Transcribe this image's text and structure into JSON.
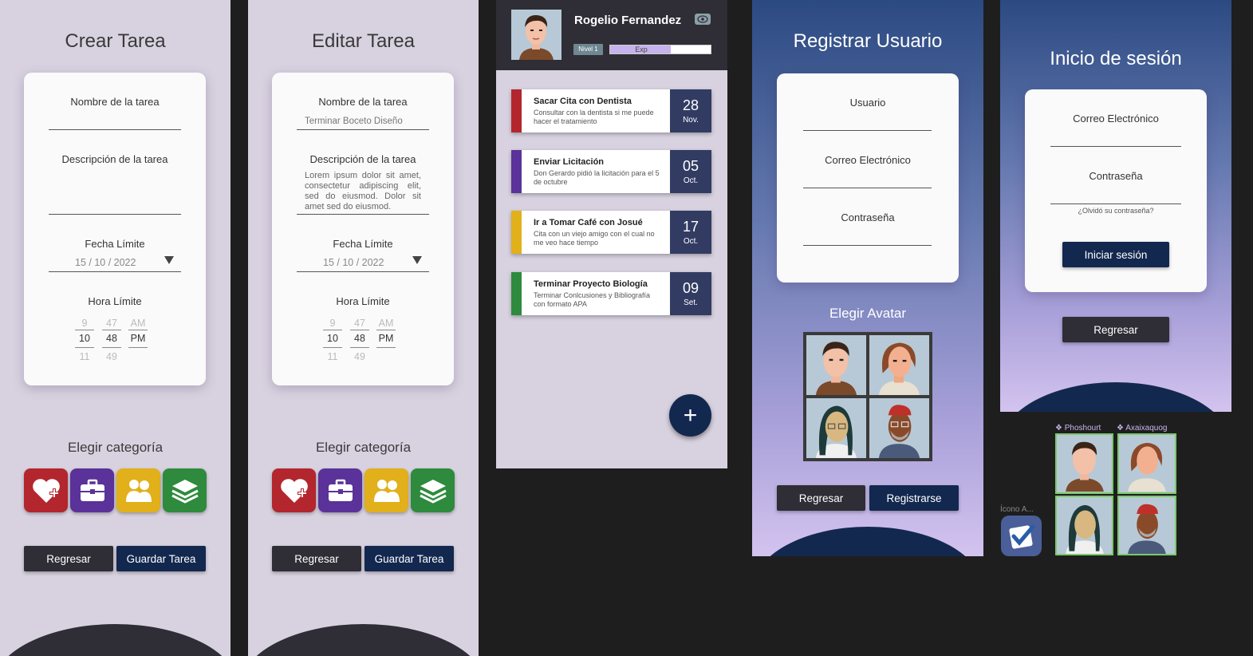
{
  "crear": {
    "title": "Crear Tarea",
    "name_label": "Nombre de la tarea",
    "desc_label": "Descripción de la tarea",
    "date_label": "Fecha Límite",
    "date_value": "15 / 10 / 2022",
    "time_label": "Hora Límite",
    "time": {
      "h_prev": "9",
      "m_prev": "47",
      "ap_prev": "AM",
      "h": "10",
      "m": "48",
      "ap": "PM",
      "h_next": "11",
      "m_next": "49"
    },
    "category_title": "Elegir categoría",
    "back_label": "Regresar",
    "save_label": "Guardar Tarea"
  },
  "editar": {
    "title": "Editar Tarea",
    "name_label": "Nombre de la tarea",
    "name_value": "Terminar Boceto Diseño",
    "desc_label": "Descripción de la tarea",
    "desc_value": "Lorem ipsum dolor sit amet, consectetur adipiscing elit, sed do eiusmod. Dolor sit amet sed do eiusmod.",
    "date_label": "Fecha Límite",
    "date_value": "15 / 10 / 2022",
    "time_label": "Hora Límite",
    "time": {
      "h_prev": "9",
      "m_prev": "47",
      "ap_prev": "AM",
      "h": "10",
      "m": "48",
      "ap": "PM",
      "h_next": "11",
      "m_next": "49"
    },
    "category_title": "Elegir categoría",
    "back_label": "Regresar",
    "save_label": "Guardar Tarea"
  },
  "categories": [
    {
      "icon": "heart-plus-icon",
      "color": "#b3262e"
    },
    {
      "icon": "briefcase-icon",
      "color": "#5a3299"
    },
    {
      "icon": "people-icon",
      "color": "#e1b01a"
    },
    {
      "icon": "books-icon",
      "color": "#2e8a3d"
    }
  ],
  "tasks_screen": {
    "user_name": "Rogelio Fernandez",
    "level": "Nivel 1",
    "exp_label": "Exp",
    "exp_progress": 0.6,
    "tasks": [
      {
        "title": "Sacar Cita con Dentista",
        "desc": "Consultar con la dentista si me puede hacer el tratamiento",
        "day": "28",
        "month": "Nov.",
        "color": "#b3262e"
      },
      {
        "title": "Enviar Licitación",
        "desc": "Don Gerardo pidió la licitación para el 5 de octubre",
        "day": "05",
        "month": "Oct.",
        "color": "#5a3299"
      },
      {
        "title": "Ir a Tomar Café con Josué",
        "desc": "Cita con un viejo amigo con el cual no me veo hace tiempo",
        "day": "17",
        "month": "Oct.",
        "color": "#e1b01a"
      },
      {
        "title": "Terminar Proyecto Biología",
        "desc": "Terminar Conlcusiones y Bibliografía con formato APA",
        "day": "09",
        "month": "Set.",
        "color": "#2e8a3d"
      }
    ],
    "fab_label": "+"
  },
  "registro": {
    "title": "Registrar Usuario",
    "user_label": "Usuario",
    "email_label": "Correo Electrónico",
    "password_label": "Contraseña",
    "avatar_title": "Elegir Avatar",
    "back_label": "Regresar",
    "register_label": "Registrarse"
  },
  "login": {
    "title": "Inicio de sesión",
    "email_label": "Correo Electrónico",
    "password_label": "Contraseña",
    "forgot_label": "¿Olvidó su contraseña?",
    "login_label": "Iniciar sesión",
    "back_label": "Regresar"
  },
  "components": {
    "comp1": "❖ Phoshourt",
    "comp2": "❖ Axaixaquog",
    "icon_label": "Ícono A..."
  },
  "colors": {
    "lavender": "#d8d2e0",
    "navy": "#13284f",
    "dark": "#2f2d35"
  }
}
